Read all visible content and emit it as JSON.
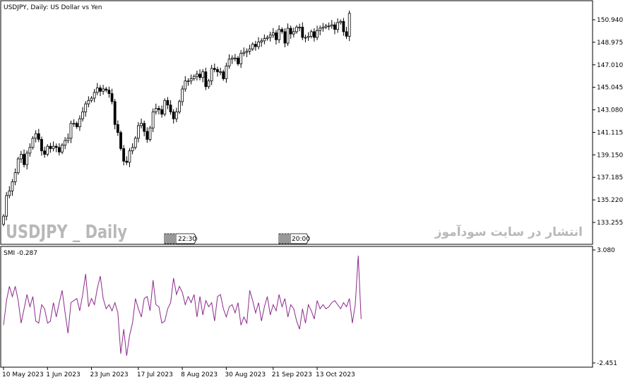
{
  "chart_data": [
    {
      "type": "candlestick",
      "title": "USDJPY, Daily:  US Dollar vs Yen",
      "watermark": "USDJPY _ Daily",
      "watermark_2": "انتشار در سایت سودآموز",
      "yticks": [
        "150.940",
        "148.975",
        "147.010",
        "145.045",
        "143.080",
        "141.115",
        "139.150",
        "137.185",
        "135.220",
        "133.255"
      ],
      "yrange": [
        132.6,
        152.2
      ],
      "markers": [
        "22:30",
        "20:00"
      ],
      "close": [
        133.8,
        135.6,
        136.0,
        136.8,
        137.6,
        138.8,
        139.2,
        138.3,
        139.3,
        139.8,
        140.6,
        141.0,
        140.5,
        139.5,
        139.2,
        139.9,
        139.7,
        139.9,
        139.8,
        139.4,
        140.0,
        140.4,
        140.6,
        141.9,
        141.9,
        141.6,
        142.3,
        142.9,
        143.6,
        143.9,
        144.1,
        144.6,
        145.0,
        144.7,
        144.9,
        144.8,
        144.5,
        143.8,
        141.8,
        141.1,
        139.7,
        138.6,
        138.5,
        139.5,
        139.8,
        140.6,
        141.7,
        141.9,
        141.2,
        140.5,
        141.5,
        142.9,
        143.2,
        143.1,
        142.7,
        143.9,
        143.5,
        142.9,
        142.3,
        142.9,
        143.8,
        144.9,
        145.6,
        145.6,
        145.8,
        146.0,
        146.2,
        145.9,
        146.4,
        145.1,
        145.6,
        146.7,
        146.6,
        146.4,
        146.4,
        145.8,
        146.9,
        147.5,
        147.6,
        147.6,
        147.1,
        148.0,
        148.1,
        148.2,
        148.4,
        148.8,
        148.6,
        149.0,
        149.1,
        149.3,
        149.4,
        149.6,
        149.8,
        149.2,
        150.1,
        149.9,
        148.9,
        150.2,
        149.7,
        149.9,
        150.3,
        150.3,
        149.4,
        149.4,
        149.5,
        149.9,
        149.4,
        150.0,
        150.2,
        150.3,
        150.4,
        150.4,
        150.5,
        150.1,
        150.7,
        150.8,
        149.9,
        149.5,
        151.5
      ]
    },
    {
      "type": "line",
      "label": "SMI -0.287",
      "yticks": [
        "3.080",
        "-2.451"
      ],
      "yrange": [
        -2.451,
        3.08
      ],
      "color": "#8b2a8b",
      "values": [
        -0.6,
        0.6,
        1.3,
        0.8,
        1.3,
        0.6,
        -0.5,
        0.2,
        0.9,
        0.3,
        0.8,
        -0.4,
        -0.5,
        0.4,
        0.2,
        -0.5,
        -0.4,
        0.5,
        -0.2,
        0.5,
        1.1,
        0.0,
        -1.0,
        0.5,
        0.6,
        0.7,
        0.1,
        0.9,
        1.9,
        0.3,
        0.7,
        0.4,
        1.2,
        1.8,
        0.7,
        0.2,
        0.4,
        0.1,
        0.5,
        0.0,
        -2.0,
        -0.8,
        -2.1,
        -1.1,
        -0.5,
        0.7,
        0.2,
        -0.2,
        0.7,
        0.8,
        0.1,
        1.6,
        0.4,
        0.3,
        -0.5,
        -0.4,
        0.2,
        0.5,
        1.7,
        0.9,
        1.3,
        1.0,
        0.4,
        0.8,
        0.5,
        0.9,
        -0.2,
        0.8,
        -0.1,
        0.6,
        0.3,
        0.5,
        -0.4,
        0.8,
        0.9,
        0.2,
        -0.2,
        0.3,
        0.4,
        0.0,
        0.5,
        -0.6,
        -0.2,
        -0.5,
        1.1,
        0.6,
        0.0,
        0.5,
        -0.4,
        0.3,
        0.8,
        -0.1,
        0.4,
        0.1,
        0.9,
        0.3,
        0.7,
        -0.2,
        0.4,
        0.2,
        -0.4,
        -0.8,
        0.2,
        -0.5,
        0.4,
        0.1,
        -0.3,
        0.6,
        0.2,
        0.4,
        0.2,
        0.3,
        0.5,
        0.6,
        0.4,
        0.2,
        0.5,
        0.3,
        0.7,
        -0.5,
        0.4,
        2.8,
        -0.3
      ]
    }
  ],
  "xticks": [
    "10 May 2023",
    "1 Jun 2023",
    "23 Jun 2023",
    "17 Jul 2023",
    "8 Aug 2023",
    "30 Aug 2023",
    "21 Sep 2023",
    "13 Oct 2023"
  ],
  "colors": {
    "candle": "#000000",
    "smi": "#8b2a8b",
    "axis": "#000000",
    "watermark": "#b8b8b8"
  }
}
